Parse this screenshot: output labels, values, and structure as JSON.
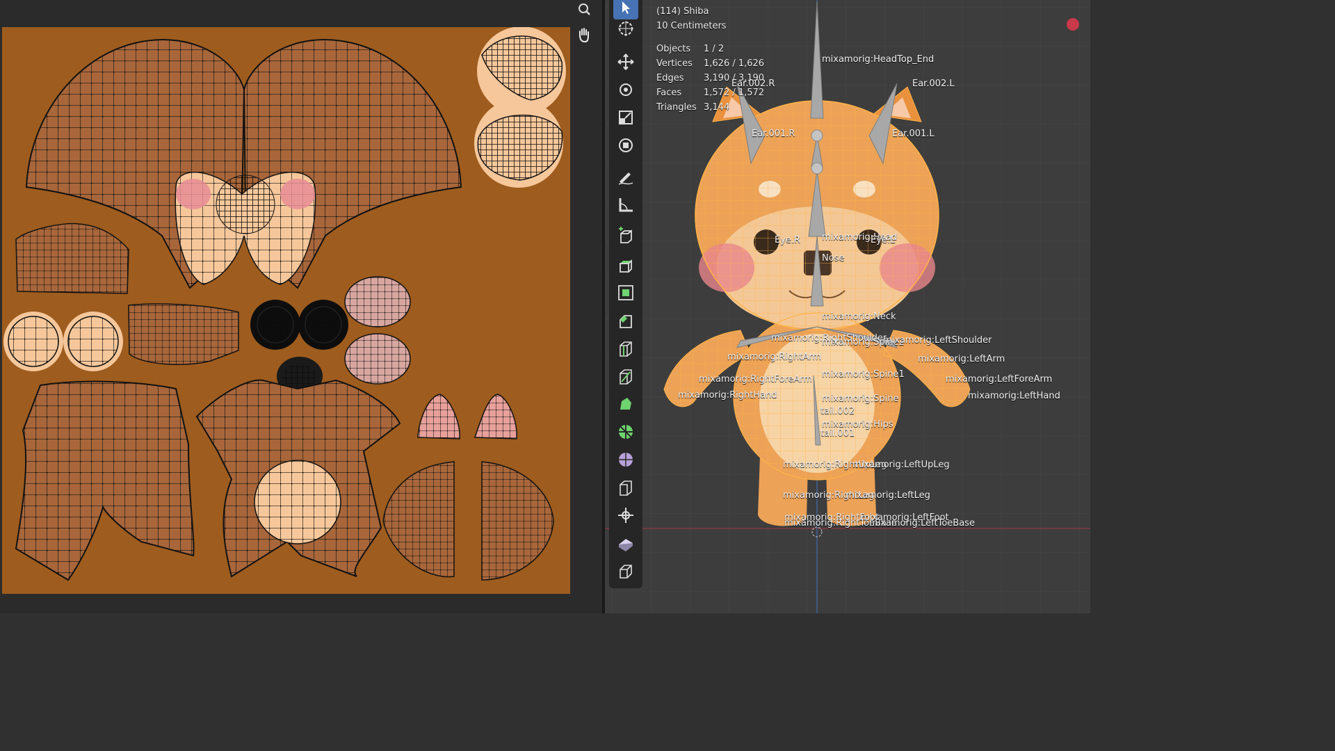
{
  "uv_editor": {
    "nav_icons": [
      "zoom-icon",
      "hand-pan-icon"
    ],
    "colors": {
      "background": "#9e5c1e",
      "island_fill": "#a8663a",
      "skin_light": "#f6c79a",
      "blush": "#e88d95",
      "wire": "#111111"
    }
  },
  "viewport": {
    "stats": {
      "object_name": "(114) Shiba",
      "scale": "10 Centimeters",
      "rows": [
        {
          "key": "Objects",
          "value": "1 / 2"
        },
        {
          "key": "Vertices",
          "value": "1,626 / 1,626"
        },
        {
          "key": "Edges",
          "value": "3,190 / 3,190"
        },
        {
          "key": "Faces",
          "value": "1,572 / 1,572"
        },
        {
          "key": "Triangles",
          "value": "3,144"
        }
      ]
    },
    "tools": [
      "select-box-icon",
      "cursor-icon",
      "move-icon",
      "rotate-icon",
      "scale-icon",
      "transform-icon",
      "annotate-icon",
      "measure-icon",
      "add-cube-icon",
      "extrude-icon",
      "inset-icon",
      "bevel-icon",
      "loop-cut-icon",
      "knife-icon",
      "poly-build-icon",
      "spin-icon",
      "smooth-icon",
      "edge-slide-icon",
      "shrink-fatten-icon",
      "shear-icon",
      "rip-icon"
    ],
    "bone_labels": [
      "mixamorig:HeadTop_End",
      "Ear.002.R",
      "Ear.002.L",
      "Ear.001.R",
      "Ear.001.L",
      "Eye.R",
      "mixamorig:Head",
      "Eye.L",
      "Nose",
      "mixamorig:Neck",
      "mixamorig:RightShoulder",
      "mixamorig:Spine2",
      "mixamorig:LeftShoulder",
      "mixamorig:RightArm",
      "mixamorig:LeftArm",
      "mixamorig:Spine1",
      "mixamorig:RightForeArm",
      "mixamorig:LeftForeArm",
      "mixamorig:RightHand",
      "mixamorig:LeftHand",
      "mixamorig:Spine",
      "tail.002",
      "mixamorig:Hips",
      "tail.001",
      "mixamorig:RightUpLeg",
      "mixamorig:LeftUpLeg",
      "mixamorig:RightLeg",
      "mixamorig:LeftLeg",
      "mixamorig:RightFoot",
      "mixamorig:LeftFoot",
      "mixamorig:RightToeBase",
      "mixamorig:LeftToeBase"
    ],
    "colors": {
      "mesh": "#f2a64a",
      "wire": "#ffb347",
      "bone": "#a8a8a8",
      "axis_red": "#c8394a",
      "axis_blue": "#3f6aa8"
    }
  }
}
